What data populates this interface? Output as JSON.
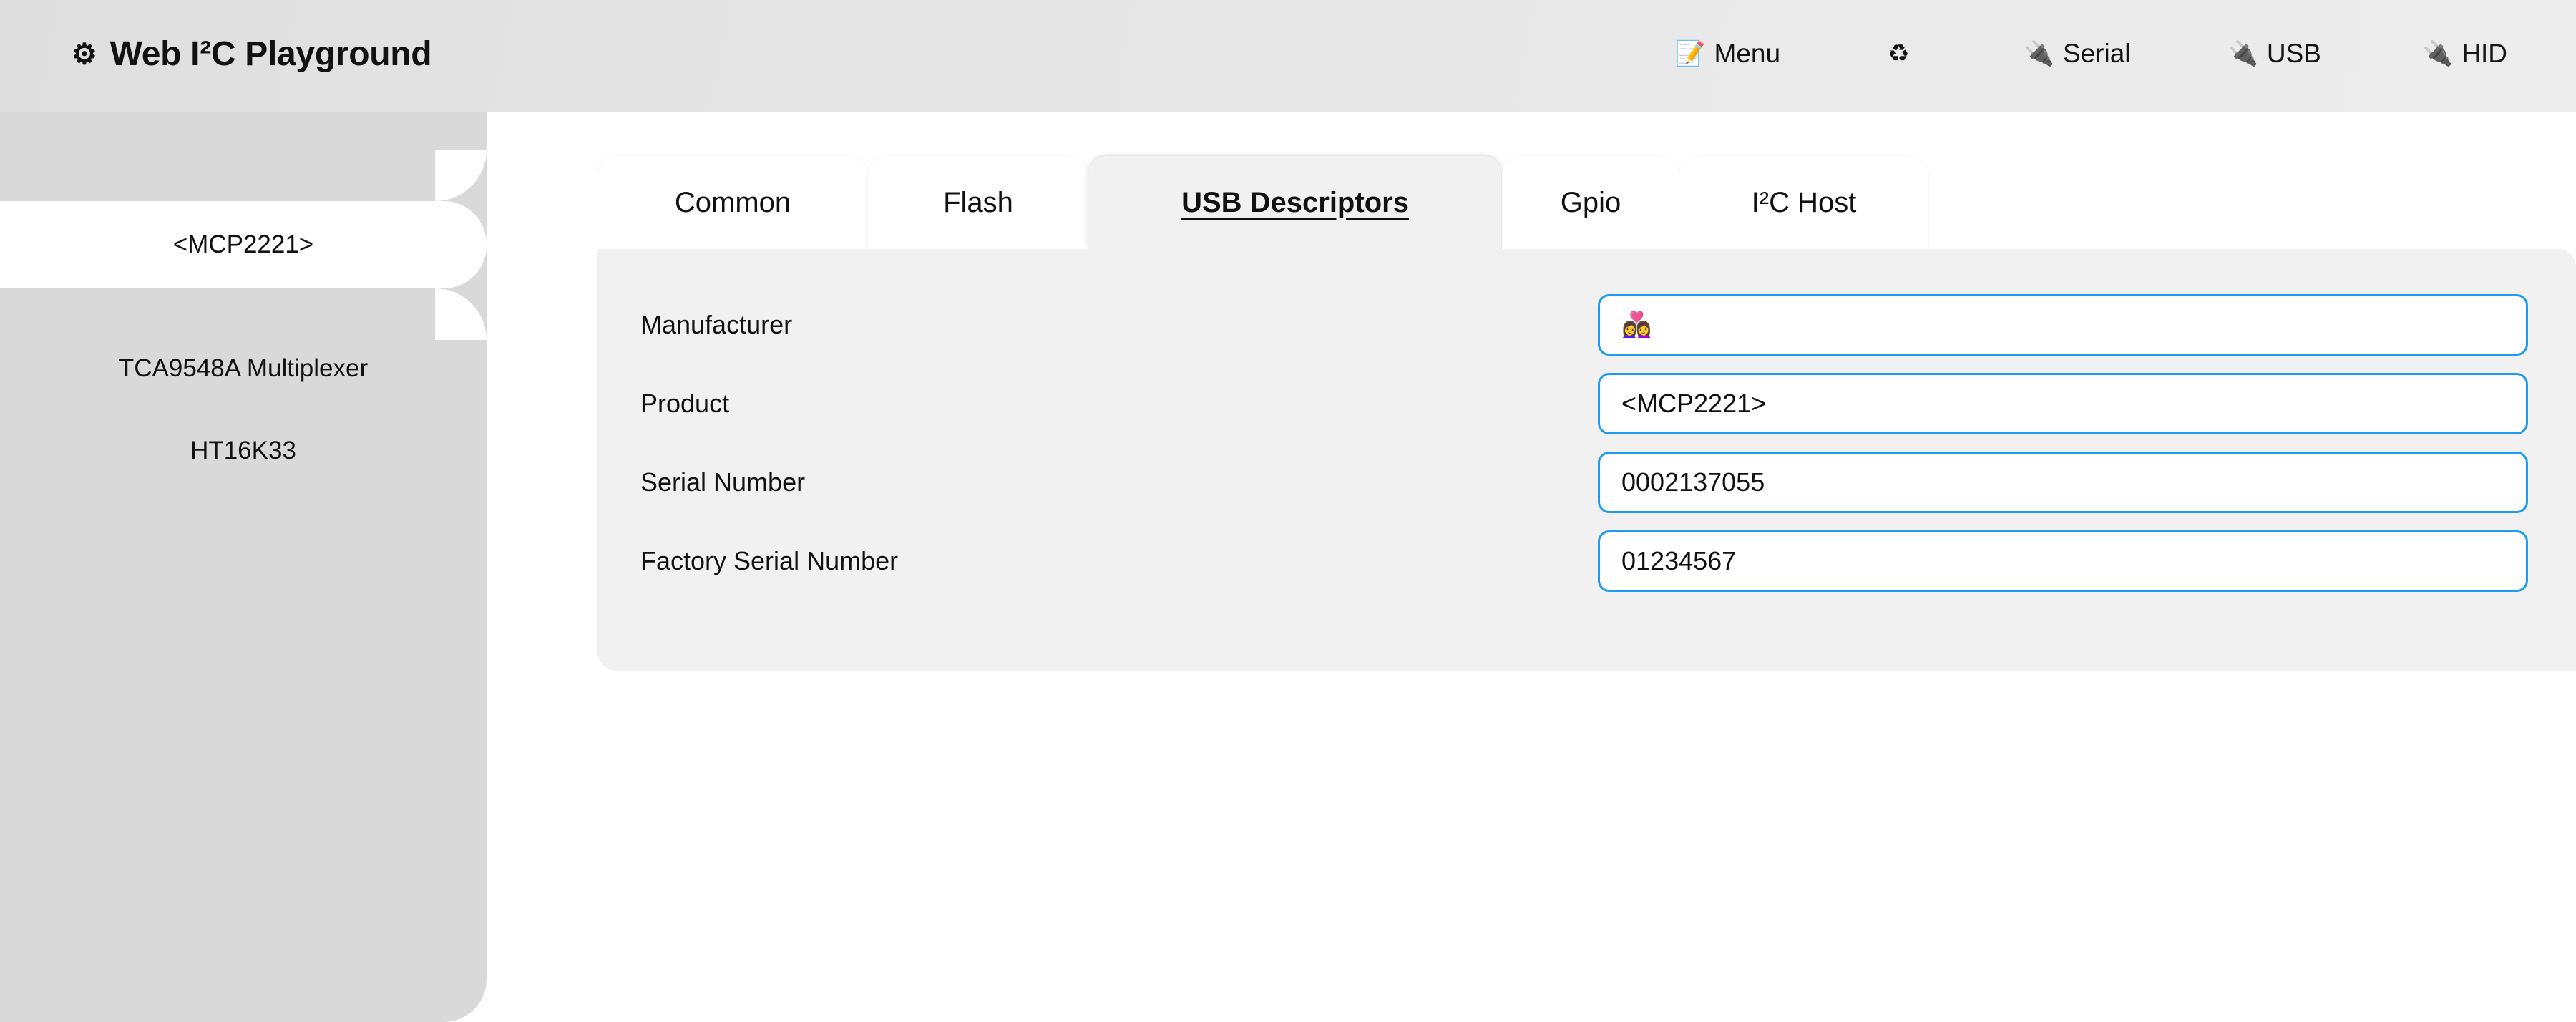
{
  "header": {
    "brand_icon": "⚙",
    "brand_title": "Web I²C Playground",
    "nav": [
      {
        "icon": "📝",
        "label": "Menu",
        "name": "nav-menu"
      },
      {
        "icon": "♻",
        "label": "",
        "name": "nav-recycle"
      },
      {
        "icon": "🔌",
        "label": "Serial",
        "name": "nav-serial"
      },
      {
        "icon": "🔌",
        "label": "USB",
        "name": "nav-usb"
      },
      {
        "icon": "🔌",
        "label": "HID",
        "name": "nav-hid"
      }
    ]
  },
  "sidebar": {
    "items": [
      {
        "label": "<MCP2221>",
        "selected": true
      },
      {
        "label": "TCA9548A Multiplexer",
        "selected": false
      },
      {
        "label": "HT16K33",
        "selected": false
      }
    ]
  },
  "tabs": [
    {
      "label": "Common",
      "active": false
    },
    {
      "label": "Flash",
      "active": false
    },
    {
      "label": "USB Descriptors",
      "active": true
    },
    {
      "label": "Gpio",
      "active": false
    },
    {
      "label": "I²C Host",
      "active": false
    }
  ],
  "form": {
    "fields": [
      {
        "label": "Manufacturer",
        "value": "👩‍❤️‍👩",
        "is_emoji": true
      },
      {
        "label": "Product",
        "value": "<MCP2221>",
        "is_emoji": false
      },
      {
        "label": "Serial Number",
        "value": "0002137055",
        "is_emoji": false
      },
      {
        "label": "Factory Serial Number",
        "value": "01234567",
        "is_emoji": false
      }
    ]
  },
  "colors": {
    "page_background": "#ffffff",
    "header_background": "#e7e7e7",
    "sidebar_background": "#d9d9d9",
    "panel_background": "#f1f1f1",
    "input_border": "#1e9bf0",
    "text": "#121212"
  }
}
